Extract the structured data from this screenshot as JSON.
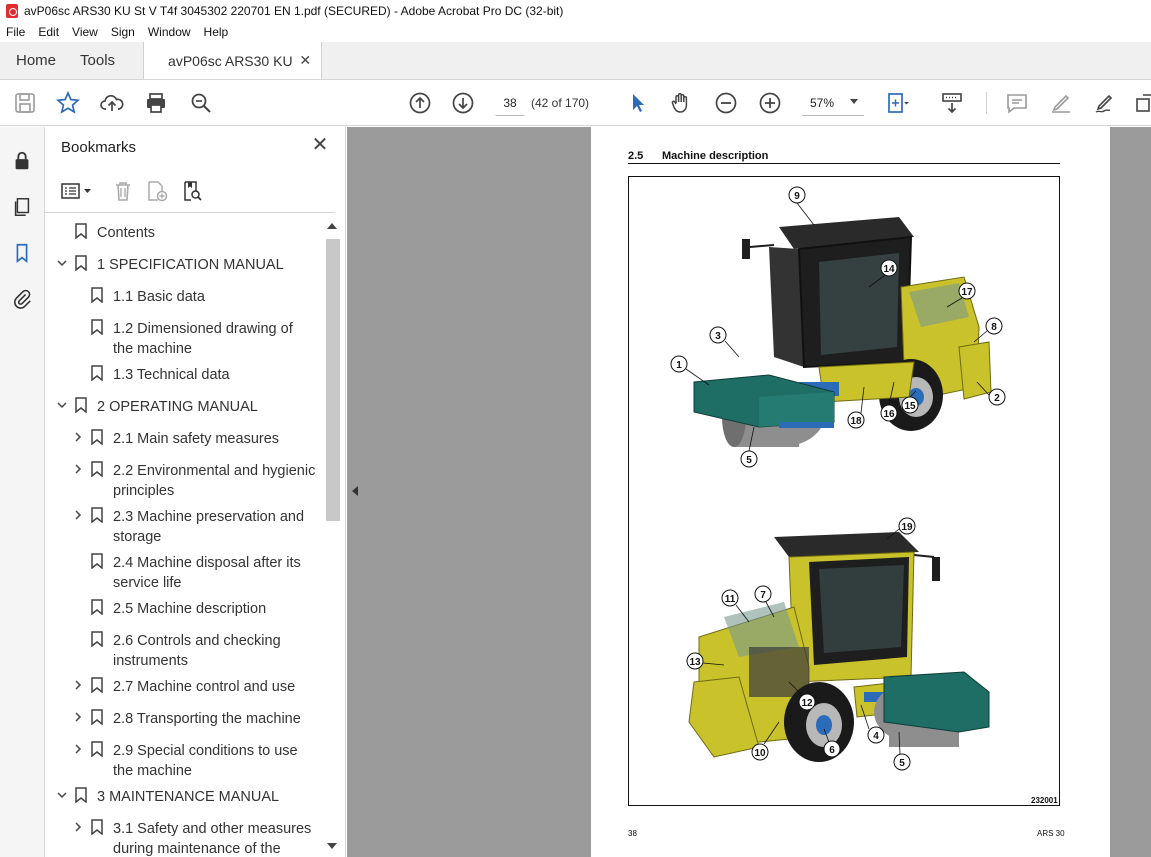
{
  "window": {
    "title": "avP06sc ARS30 KU St V T4f 3045302 220701 EN 1.pdf (SECURED) - Adobe Acrobat Pro DC (32-bit)"
  },
  "menu": {
    "items": [
      "File",
      "Edit",
      "View",
      "Sign",
      "Window",
      "Help"
    ]
  },
  "tabs": {
    "home": "Home",
    "tools": "Tools",
    "document": "avP06sc ARS30 KU ..."
  },
  "toolbar": {
    "current_page": "38",
    "page_count": "(42 of 170)",
    "zoom": "57%"
  },
  "bookmarks": {
    "title": "Bookmarks",
    "items": [
      {
        "label": "Contents",
        "expandable": false
      },
      {
        "label": "1 SPECIFICATION MANUAL",
        "expandable": true,
        "expanded": true
      },
      {
        "label": "1.1 Basic data",
        "expandable": false
      },
      {
        "label": "1.2 Dimensioned drawing of the machine",
        "expandable": false
      },
      {
        "label": "1.3 Technical data",
        "expandable": false
      },
      {
        "label": "2 OPERATING MANUAL",
        "expandable": true,
        "expanded": true
      },
      {
        "label": "2.1 Main safety measures",
        "expandable": true,
        "expanded": false
      },
      {
        "label": "2.2 Environmental and hygienic principles",
        "expandable": true,
        "expanded": false
      },
      {
        "label": "2.3 Machine preservation and storage",
        "expandable": true,
        "expanded": false
      },
      {
        "label": "2.4 Machine disposal after its service life",
        "expandable": false
      },
      {
        "label": "2.5 Machine description",
        "expandable": false
      },
      {
        "label": "2.6 Controls and checking instruments",
        "expandable": false
      },
      {
        "label": "2.7 Machine control and use",
        "expandable": true,
        "expanded": false
      },
      {
        "label": "2.8 Transporting the machine",
        "expandable": true,
        "expanded": false
      },
      {
        "label": "2.9 Special conditions to use the machine",
        "expandable": true,
        "expanded": false
      },
      {
        "label": "3 MAINTENANCE MANUAL",
        "expandable": true,
        "expanded": true
      },
      {
        "label": "3.1 Safety and other measures during maintenance of the",
        "expandable": true,
        "expanded": false
      }
    ]
  },
  "page": {
    "section_number": "2.5",
    "section_title": "Machine description",
    "figure_id": "232001",
    "footer_page": "38",
    "footer_model": "ARS 30",
    "top_callouts": [
      "9",
      "14",
      "17",
      "8",
      "3",
      "1",
      "2",
      "15",
      "16",
      "18",
      "5"
    ],
    "bottom_callouts": [
      "19",
      "11",
      "7",
      "13",
      "12",
      "10",
      "6",
      "4",
      "5"
    ]
  },
  "colors": {
    "accent_blue": "#2b6cb8",
    "machine_yellow": "#c9c22a",
    "drum_teal": "#1f6e66",
    "background_gray": "#9b9b9b"
  }
}
